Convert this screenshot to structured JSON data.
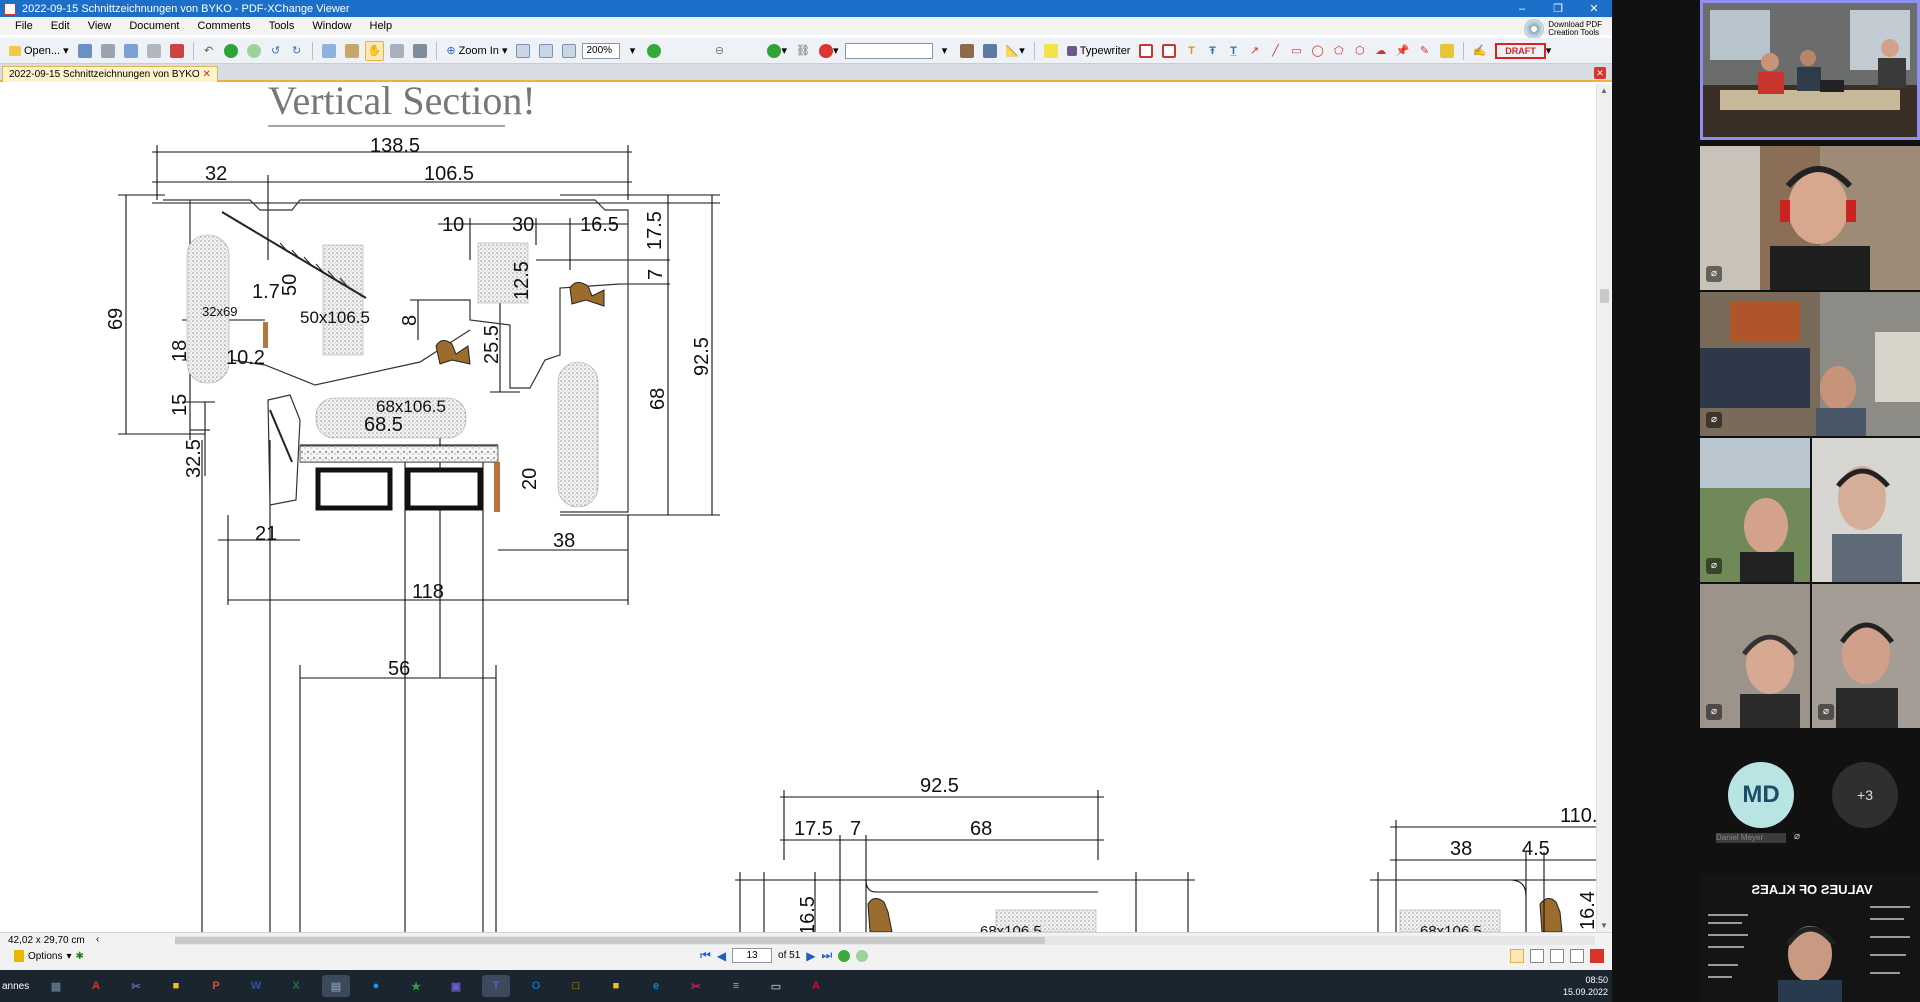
{
  "window": {
    "title": "2022-09-15 Schnittzeichnungen von BYKO - PDF-XChange Viewer",
    "controls": {
      "minimize": "–",
      "restore": "❐",
      "close": "✕"
    }
  },
  "menu": {
    "items": [
      "File",
      "Edit",
      "View",
      "Document",
      "Comments",
      "Tools",
      "Window",
      "Help"
    ]
  },
  "pdf_tools": {
    "line1": "Download PDF",
    "line2": "Creation Tools"
  },
  "toolbar": {
    "open_label": "Open...",
    "zoom_in_label": "Zoom In",
    "zoom_value": "200%",
    "typewriter_label": "Typewriter",
    "draft_label": "DRAFT",
    "search_value": ""
  },
  "tab": {
    "label": "2022-09-15 Schnittzeichnungen von BYKO"
  },
  "drawing": {
    "title": "Vertical Section!",
    "dims": {
      "d1385": "138.5",
      "d32": "32",
      "d1065": "106.5",
      "d10": "10",
      "d30": "30",
      "d165": "16.5",
      "d175": "17.5",
      "d69": "69",
      "d17": "1.7",
      "d50": "50",
      "d125": "12.5",
      "d7": "7",
      "d32x69": "32x69",
      "d50x1065": "50x106.5",
      "d8": "8",
      "d18": "18",
      "d102": "10.2",
      "d255": "25.5",
      "d925": "92.5",
      "d15": "15",
      "d68x1065": "68x106.5",
      "d685": "68.5",
      "d68": "68",
      "d325": "32.5",
      "d20": "20",
      "d21": "21",
      "d38": "38",
      "d118": "118",
      "d56": "56",
      "b925": "92.5",
      "b175": "17.5",
      "b7": "7",
      "b68": "68",
      "b165": "16.5",
      "b68x": "68x106.5",
      "c110": "110.",
      "c38": "38",
      "c45": "4.5",
      "c68x": "68x106.5",
      "c164": "16.4"
    }
  },
  "status": {
    "page_size": "42,02 x 29,70 cm",
    "options_label": "Options",
    "page_current": "13",
    "page_total": "of 51"
  },
  "taskbar": {
    "start_label": "annes",
    "apps": [
      "calculator",
      "acrobat",
      "snip",
      "sticky-notes",
      "powerpoint",
      "word",
      "excel",
      "pdf-viewer",
      "edge-legacy",
      "ps",
      "rdp",
      "teams",
      "outlook",
      "explorer",
      "files",
      "edge",
      "snipping",
      "database",
      "monitor",
      "autocad"
    ],
    "app_glyphs": [
      "▦",
      "A",
      "✂",
      "■",
      "P",
      "W",
      "X",
      "▤",
      "●",
      "★",
      "▣",
      "T",
      "O",
      "□",
      "■",
      "e",
      "✂",
      "≡",
      "▭",
      "A"
    ],
    "app_colors": [
      "#5f7488",
      "#d9342b",
      "#5b6ea8",
      "#f4c020",
      "#d35230",
      "#2b5797",
      "#217346",
      "#7a8ea8",
      "#1e90ff",
      "#2f9e45",
      "#6a5acd",
      "#5b5fc7",
      "#0f6cbd",
      "#e3a500",
      "#f4c020",
      "#0a84d6",
      "#c8254a",
      "#9aa4ae",
      "#9aa4ae",
      "#c8102e"
    ],
    "time": "08:50",
    "date": "15.09.2022"
  },
  "participants": {
    "md_initials": "MD",
    "md_name": "Daniel Meyer",
    "more_count": "+3",
    "slide_title": "VALUES OF KLAES"
  }
}
